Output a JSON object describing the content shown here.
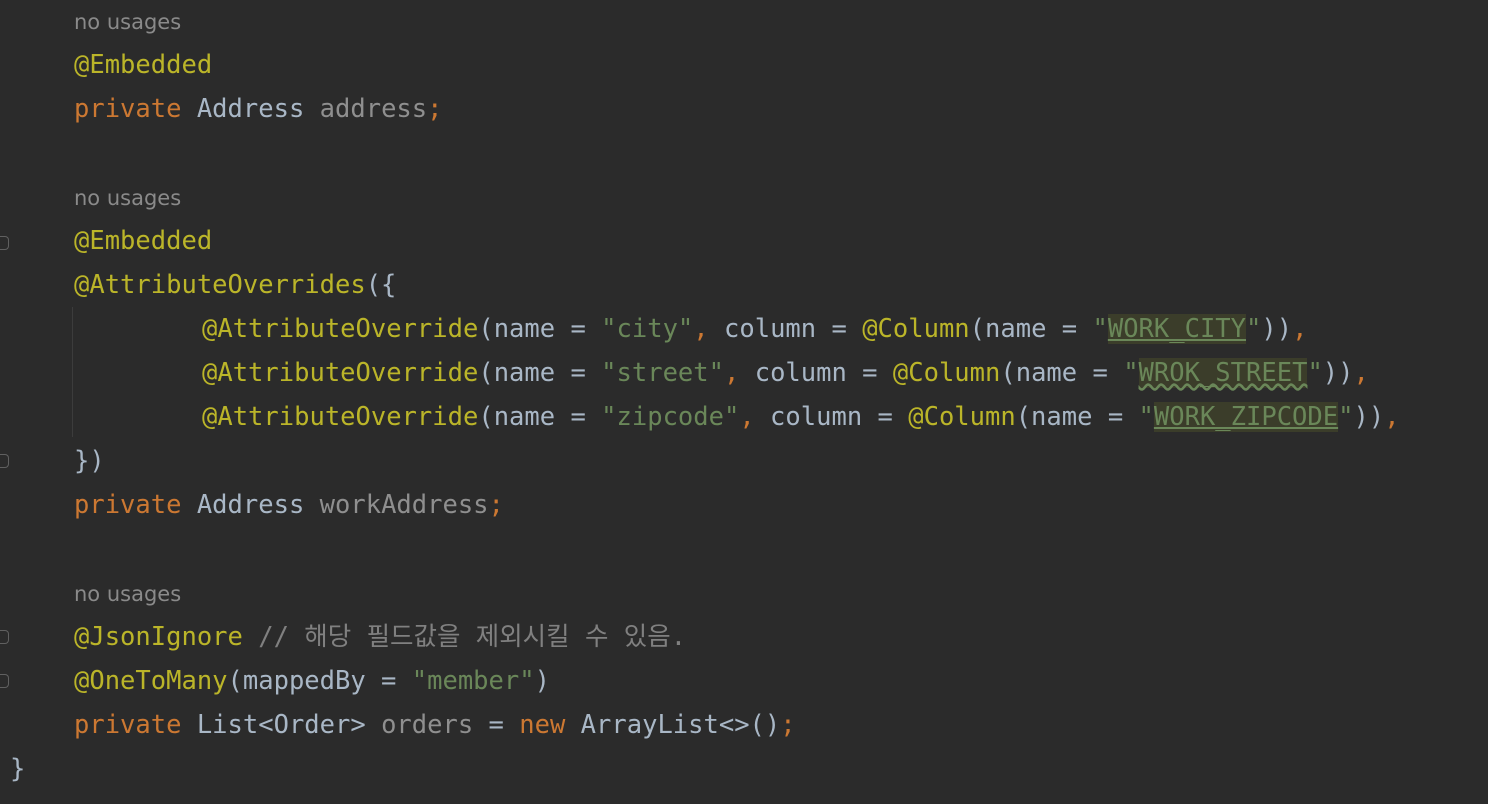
{
  "editor": {
    "hints": {
      "no_usages": "no usages"
    },
    "block1": {
      "annotation": "@Embedded",
      "private_kw": "private",
      "type": "Address",
      "field": "address",
      "semicolon": ";"
    },
    "block2": {
      "annotation_embedded": "@Embedded",
      "annotation_overrides": "@AttributeOverrides",
      "open_paren": "({",
      "overrides": [
        {
          "ann": "@AttributeOverride",
          "p1": "(name = ",
          "name_str": "\"city\"",
          "comma": ",",
          "p2": " column = ",
          "col_ann": "@Column",
          "p3": "(name = ",
          "q1": "\"",
          "col_name": "WORK_CITY",
          "q2": "\"",
          "close": "))",
          "end": ","
        },
        {
          "ann": "@AttributeOverride",
          "p1": "(name = ",
          "name_str": "\"street\"",
          "comma": ",",
          "p2": " column = ",
          "col_ann": "@Column",
          "p3": "(name = ",
          "q1": "\"",
          "col_name": "WROK_STREET",
          "q2": "\"",
          "close": "))",
          "end": ","
        },
        {
          "ann": "@AttributeOverride",
          "p1": "(name = ",
          "name_str": "\"zipcode\"",
          "comma": ",",
          "p2": " column = ",
          "col_ann": "@Column",
          "p3": "(name = ",
          "q1": "\"",
          "col_name": "WORK_ZIPCODE",
          "q2": "\"",
          "close": "))",
          "end": ","
        }
      ],
      "close": "})",
      "private_kw": "private",
      "type": "Address",
      "field": "workAddress",
      "semicolon": ";"
    },
    "block3": {
      "annotation_json": "@JsonIgnore",
      "comment": " // 해당 필드값을 제외시킬 수 있음.",
      "annotation_otm": "@OneToMany",
      "otm_open": "(mappedBy = ",
      "otm_str": "\"member\"",
      "otm_close": ")",
      "private_kw": "private",
      "type": "List<Order>",
      "field": "orders",
      "assign": " = ",
      "new_kw": "new",
      "ctor": " ArrayList<>()",
      "semicolon": ";"
    },
    "class_close": "}"
  },
  "colors": {
    "background": "#2b2b2b",
    "annotation": "#bbb529",
    "keyword": "#cc7832",
    "string": "#6a8759",
    "default_text": "#a9b7c6",
    "comment": "#808080"
  }
}
